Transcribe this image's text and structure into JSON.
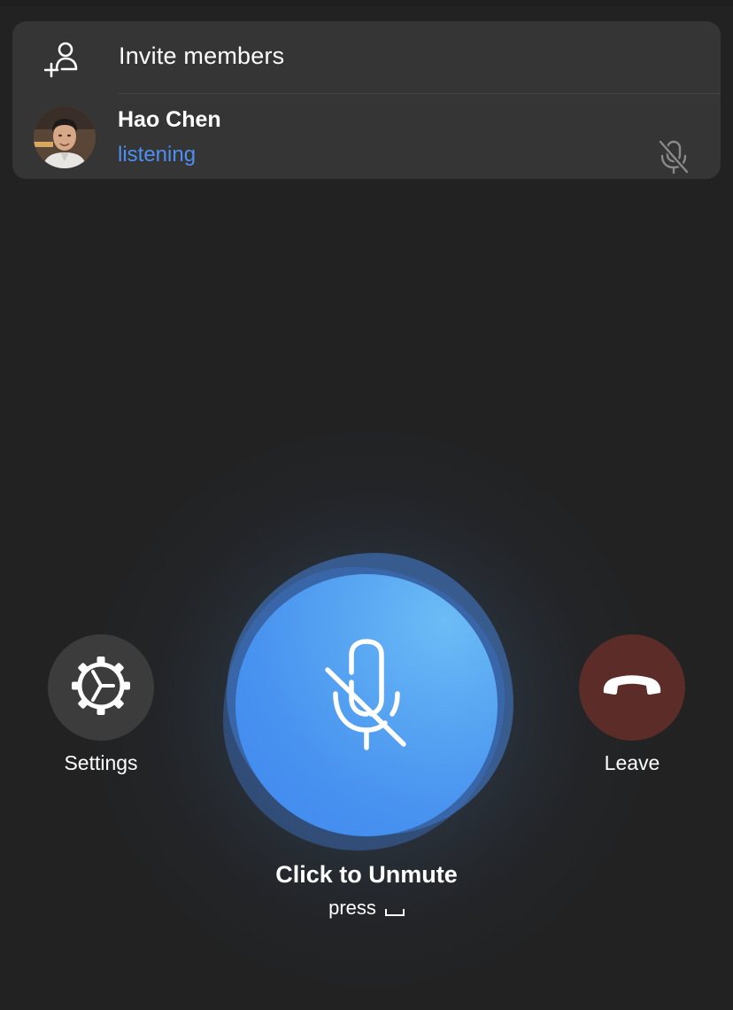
{
  "panel": {
    "invite_label": "Invite members",
    "invite_icon": "add-user-icon",
    "members": [
      {
        "name": "Hao Chen",
        "status": "listening",
        "status_color": "#4c8ff0",
        "mic_icon": "mic-muted-icon"
      }
    ]
  },
  "controls": {
    "settings_label": "Settings",
    "settings_icon": "gear-icon",
    "leave_label": "Leave",
    "leave_icon": "hang-up-phone-icon",
    "leave_color": "#5c2c28",
    "mic_icon": "mic-muted-icon",
    "mic_color": "#4892f0",
    "unmute_label": "Click to Unmute",
    "hint_label": "press"
  }
}
